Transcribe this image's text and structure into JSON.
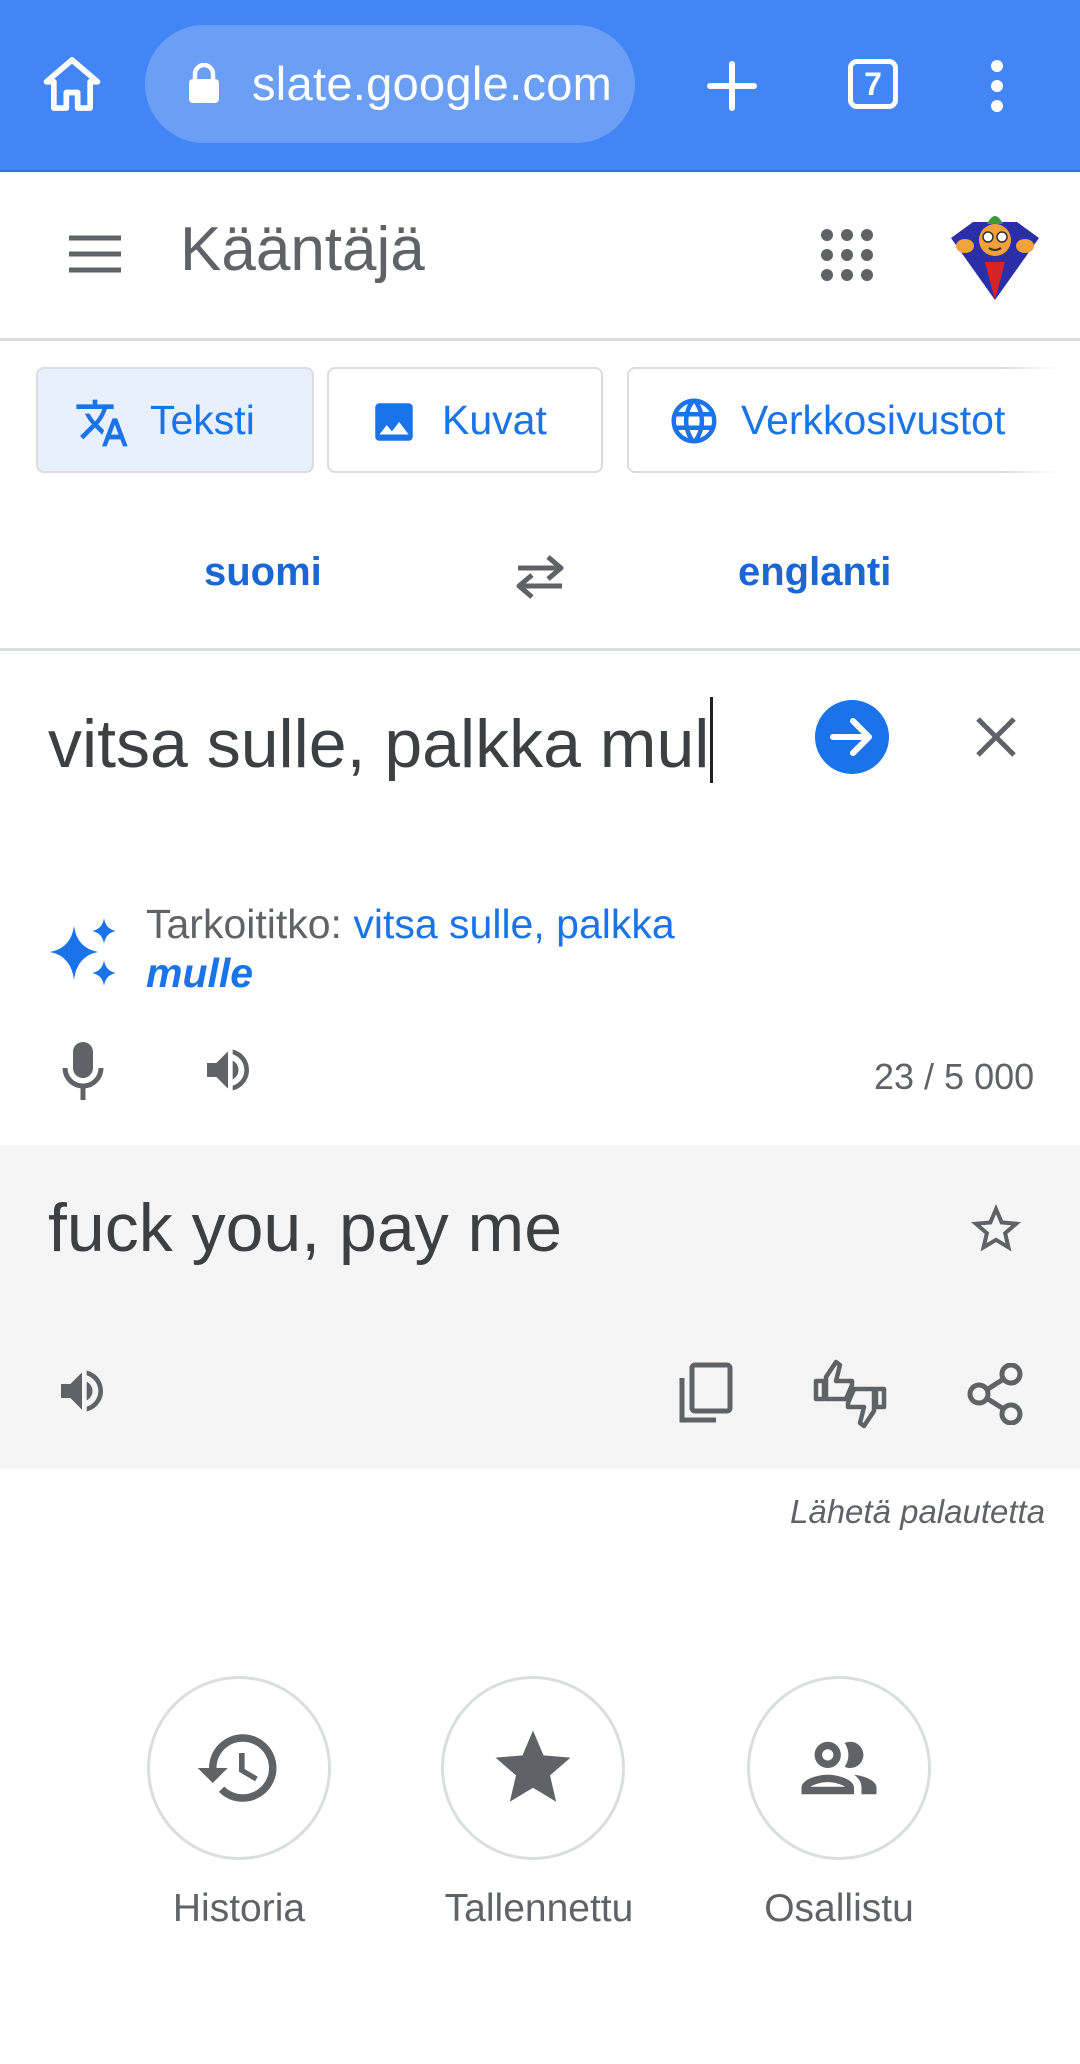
{
  "browser": {
    "url": "slate.google.com",
    "tab_count": "7"
  },
  "header": {
    "title": "Kääntäjä"
  },
  "mode_tabs": [
    {
      "label": "Teksti",
      "active": true,
      "icon": "translate-icon"
    },
    {
      "label": "Kuvat",
      "active": false,
      "icon": "image-icon"
    },
    {
      "label": "Verkkosivustot",
      "active": false,
      "icon": "globe-icon"
    }
  ],
  "languages": {
    "source": "suomi",
    "target": "englanti"
  },
  "input": {
    "text": "vitsa sulle, palkka mul"
  },
  "suggestion": {
    "prefix": "Tarkoititko: ",
    "normal": "vitsa sulle, palkka",
    "corrected": "mulle"
  },
  "char_count": "23 / 5 000",
  "output": {
    "text": "fuck you, pay me"
  },
  "feedback_link": "Lähetä palautetta",
  "bottom_actions": [
    {
      "label": "Historia",
      "icon": "history-icon"
    },
    {
      "label": "Tallennettu",
      "icon": "star-icon"
    },
    {
      "label": "Osallistu",
      "icon": "people-icon"
    }
  ],
  "colors": {
    "browser_bar": "#4285f4",
    "accent": "#1a73e8",
    "output_bg": "#f5f5f5"
  }
}
